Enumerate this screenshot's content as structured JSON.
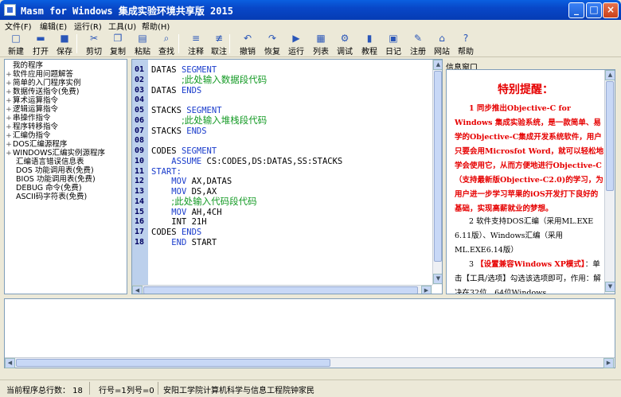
{
  "window": {
    "title": "Masm for Windows 集成实验环境共享版 2015",
    "min": "_",
    "max": "□",
    "close": "×"
  },
  "menu": [
    "文件(F)",
    "编辑(E)",
    "运行(R)",
    "工具(U)",
    "帮助(H)"
  ],
  "toolbar": [
    {
      "label": "新建",
      "icon": "new-file-icon",
      "glyph": "□"
    },
    {
      "label": "打开",
      "icon": "folder-icon",
      "glyph": "▬"
    },
    {
      "label": "保存",
      "icon": "save-icon",
      "glyph": "■"
    },
    {
      "label": "剪切",
      "icon": "cut-icon",
      "glyph": "✂"
    },
    {
      "label": "复制",
      "icon": "copy-icon",
      "glyph": "❐"
    },
    {
      "label": "粘贴",
      "icon": "paste-icon",
      "glyph": "▤"
    },
    {
      "label": "查找",
      "icon": "find-icon",
      "glyph": "⌕"
    },
    {
      "label": "注释",
      "icon": "comment-icon",
      "glyph": "≡"
    },
    {
      "label": "取注",
      "icon": "uncomment-icon",
      "glyph": "≢"
    },
    {
      "label": "撤销",
      "icon": "undo-icon",
      "glyph": "↶"
    },
    {
      "label": "恢复",
      "icon": "redo-icon",
      "glyph": "↷"
    },
    {
      "label": "运行",
      "icon": "run-icon",
      "glyph": "▶"
    },
    {
      "label": "列表",
      "icon": "list-icon",
      "glyph": "▦"
    },
    {
      "label": "调试",
      "icon": "debug-icon",
      "glyph": "⚙"
    },
    {
      "label": "教程",
      "icon": "tutorial-icon",
      "glyph": "▮"
    },
    {
      "label": "日记",
      "icon": "diary-icon",
      "glyph": "▣"
    },
    {
      "label": "注册",
      "icon": "register-icon",
      "glyph": "✎"
    },
    {
      "label": "网站",
      "icon": "home-icon",
      "glyph": "⌂"
    },
    {
      "label": "帮助",
      "icon": "help-icon",
      "glyph": "?"
    }
  ],
  "tree": [
    {
      "label": "我的程序",
      "exp": ""
    },
    {
      "label": "软件应用问题解答",
      "exp": "+"
    },
    {
      "label": "简单的入门程序实例",
      "exp": "+"
    },
    {
      "label": "数据传送指令(免费)",
      "exp": "+"
    },
    {
      "label": "算术运算指令",
      "exp": "+"
    },
    {
      "label": "逻辑运算指令",
      "exp": "+"
    },
    {
      "label": "串操作指令",
      "exp": "+"
    },
    {
      "label": "程序转移指令",
      "exp": "+"
    },
    {
      "label": "汇编伪指令",
      "exp": "+"
    },
    {
      "label": "DOS汇编源程序",
      "exp": "+"
    },
    {
      "label": "WINDOWS汇编实例源程序",
      "exp": "+"
    },
    {
      "label": "汇编语言错误信息表",
      "exp": ""
    },
    {
      "label": "DOS 功能调用表(免费)",
      "exp": ""
    },
    {
      "label": "BIOS 功能调用表(免费)",
      "exp": ""
    },
    {
      "label": "DEBUG 命令(免费)",
      "exp": ""
    },
    {
      "label": "ASCII码字符表(免费)",
      "exp": ""
    }
  ],
  "code": [
    {
      "n": "01",
      "pre": "DATAS ",
      "kw": "SEGMENT",
      "post": "",
      "cm": ""
    },
    {
      "n": "02",
      "pre": "      ",
      "kw": "",
      "post": "",
      "cm": ";此处输入数据段代码"
    },
    {
      "n": "03",
      "pre": "DATAS ",
      "kw": "ENDS",
      "post": "",
      "cm": ""
    },
    {
      "n": "04",
      "pre": "",
      "kw": "",
      "post": "",
      "cm": ""
    },
    {
      "n": "05",
      "pre": "STACKS ",
      "kw": "SEGMENT",
      "post": "",
      "cm": ""
    },
    {
      "n": "06",
      "pre": "      ",
      "kw": "",
      "post": "",
      "cm": ";此处输入堆栈段代码"
    },
    {
      "n": "07",
      "pre": "STACKS ",
      "kw": "ENDS",
      "post": "",
      "cm": ""
    },
    {
      "n": "08",
      "pre": "",
      "kw": "",
      "post": "",
      "cm": ""
    },
    {
      "n": "09",
      "pre": "CODES ",
      "kw": "SEGMENT",
      "post": "",
      "cm": ""
    },
    {
      "n": "10",
      "pre": "    ",
      "kw": "ASSUME",
      "post": " CS:CODES,DS:DATAS,SS:STACKS",
      "cm": ""
    },
    {
      "n": "11",
      "pre": "",
      "kw": "START:",
      "post": "",
      "cm": ""
    },
    {
      "n": "12",
      "pre": "    ",
      "kw": "MOV",
      "post": " AX,DATAS",
      "cm": ""
    },
    {
      "n": "13",
      "pre": "    ",
      "kw": "MOV",
      "post": " DS,AX",
      "cm": ""
    },
    {
      "n": "14",
      "pre": "    ",
      "kw": "",
      "post": "",
      "cm": ";此处输入代码段代码"
    },
    {
      "n": "15",
      "pre": "    ",
      "kw": "MOV",
      "post": " AH,4CH",
      "cm": ""
    },
    {
      "n": "16",
      "pre": "    INT 21H",
      "kw": "",
      "post": "",
      "cm": ""
    },
    {
      "n": "17",
      "pre": "CODES ",
      "kw": "ENDS",
      "post": "",
      "cm": ""
    },
    {
      "n": "18",
      "pre": "    ",
      "kw": "END",
      "post": " START",
      "cm": ""
    }
  ],
  "info": {
    "title": "信息窗口",
    "heading": "特别提醒：",
    "p1": "1 同步推出Objective-C for Windows 集成实验系统，是一款简单、易学的Objective-C集成开发系统软件，用户只要会用Microsfot Word，就可以轻松地学会使用它，从而方便地进行Objective-C（支持最新版Objective-C2.0)的学习，为用户进一步学习苹果的iOS开发打下良好的基础，实现高薪就业的梦想。",
    "p2": "2 软件支持DOS汇编（采用ML.EXE 6.11版）、Windows汇编（采用ML.EXE6.14版）",
    "p3a": "3 ",
    "p3b": "【设置兼容Windows XP模式】",
    "p3c": "：单击【工具/选项】勾选该选项即可，作用：解决在32位、64位Windows"
  },
  "status": {
    "total": "当前程序总行数： 18",
    "row": "行号=1",
    "col": "列号=0",
    "org": "安阳工学院计算机科学与信息工程院",
    "author": "钟家民"
  }
}
